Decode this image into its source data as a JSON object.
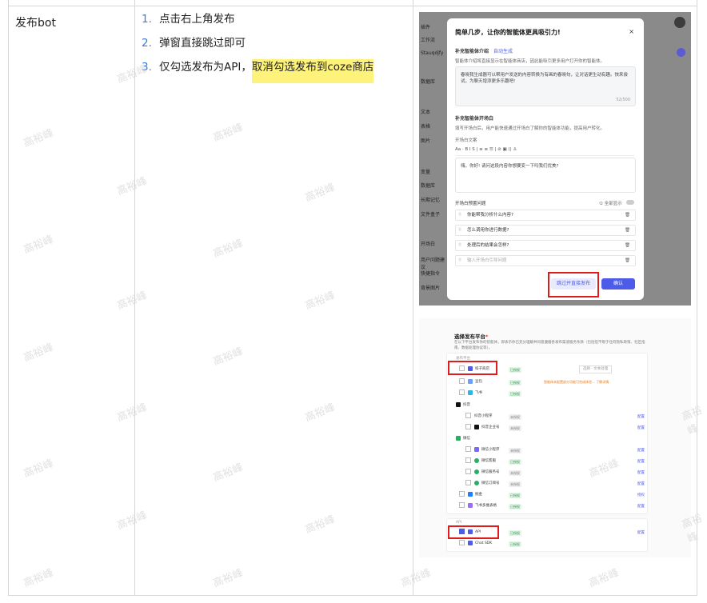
{
  "row_title": "发布bot",
  "steps": [
    {
      "num": "1.",
      "text": "点击右上角发布"
    },
    {
      "num": "2.",
      "text": "弹窗直接跳过即可"
    },
    {
      "num": "3.",
      "text": "仅勾选发布为API，",
      "highlight": "取消勾选发布到coze商店"
    }
  ],
  "watermark": "高裕峰",
  "shot1": {
    "sidebar": [
      "插件",
      "工作流",
      "Stauqdjfy",
      "数据库",
      "文本",
      "表格",
      "图片",
      "变量",
      "数据库",
      "长期记忆",
      "文件盒子",
      "开场白",
      "用户问题建议",
      "快捷指令",
      "背景图片"
    ],
    "title": "简单几步，让你的智能体更具吸引力!",
    "close": "×",
    "sec1_title": "补充智能体介绍",
    "sec1_link": "自动生成",
    "sec1_desc": "智能体介绍将直接显示在智能体商店，因此能吸引更多用户打开你的智能体。",
    "intro_text": "春晓我生成器可以帮用户发送的内容转换为有画的春晓句，让对话更生动有趣。快来尝试，为聊天增添更多乐趣吧!",
    "intro_count": "52/500",
    "sec2_title": "补充智能体开场白",
    "sec2_desc": "填写开场白后，用户能快速通过开场白了解你的智能体功能，提高用户转化。",
    "opening_label": "开场白文案",
    "toolbar": "Aa ·  B  I  S  |  ≡  ≡  ☰  |  ⊘  ▣  ⟨⟩  ♙",
    "opening_text": "嗨，你好! 请问这段内容你想要变一下吗我们优美?",
    "preset_label": "开场白预置问题",
    "preset_toggle_label": "① 全部显示",
    "questions": [
      "你能帮我分析什么内容?",
      "怎么调用你进行数据?",
      "处理后的结果会怎样?",
      "输入开场白引导问题"
    ],
    "skip_label": "跳过并直接发布",
    "confirm_label": "确认"
  },
  "shot2": {
    "title": "选择发布平台",
    "desc": "在以下平台发布你的智能体，即表示你已充分理解并同意遵循各发布渠道服务条款（包括但不限于任何隐私政策、社区指南、数据处理协议等）。",
    "header_row": "发布平台",
    "rows": [
      {
        "name": "扣子商店",
        "status": "已授权",
        "ok": true
      },
      {
        "name": "豆包",
        "status": "已授权",
        "ok": true
      },
      {
        "name": "飞书",
        "status": "已授权",
        "ok": true
      },
      {
        "name": "抖音",
        "status": "",
        "ok": true
      },
      {
        "name": "抖音小程序",
        "status": "未授权",
        "ok": false,
        "action": "配置"
      },
      {
        "name": "抖音企业号",
        "status": "未授权",
        "ok": false,
        "action": "配置"
      },
      {
        "name": "微信",
        "status": "",
        "ok": true
      },
      {
        "name": "微信小程序",
        "status": "未授权",
        "ok": false,
        "action": "配置"
      },
      {
        "name": "微信客服",
        "status": "已授权",
        "ok": true,
        "action": "配置"
      },
      {
        "name": "微信服务号",
        "status": "未授权",
        "ok": false,
        "action": "配置"
      },
      {
        "name": "微信订阅号",
        "status": "未授权",
        "ok": false,
        "action": "配置"
      },
      {
        "name": "掘金",
        "status": "已授权",
        "ok": true,
        "action": "授权"
      },
      {
        "name": "飞书多维表格",
        "status": "已授权",
        "ok": true,
        "action": "配置"
      }
    ],
    "store_select": "选择 · 文本处理",
    "doubao_note": "智能体未配置部分功能可完成体验…  了解详情",
    "api_group": "API",
    "api_rows": [
      {
        "name": "API",
        "status": "已授权",
        "ok": true,
        "action": "配置"
      },
      {
        "name": "Chat SDK",
        "status": "已授权",
        "ok": true
      }
    ]
  },
  "colors": {
    "accent": "#4d5ce6",
    "highlight": "#fdf27a",
    "annotation": "#e01b1b",
    "list_number": "#3a7be0"
  }
}
